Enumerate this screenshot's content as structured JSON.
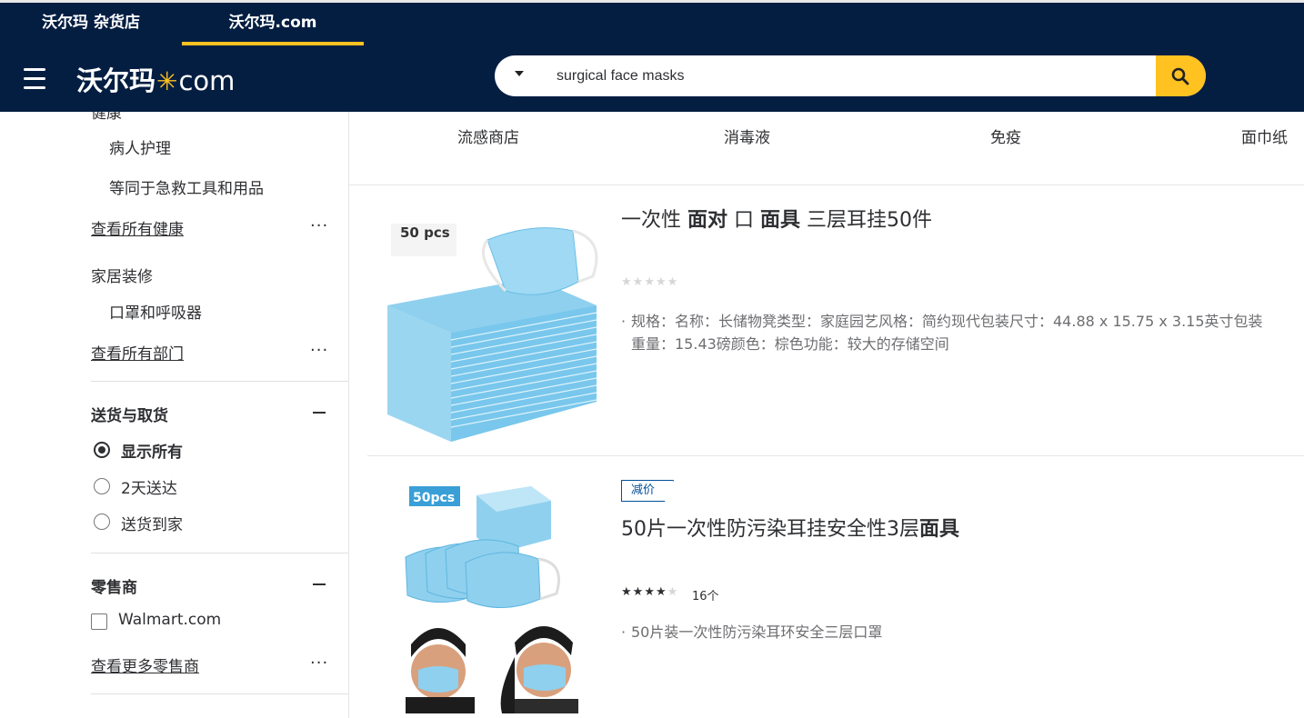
{
  "header": {
    "tabs": [
      {
        "label": "沃尔玛 杂货店",
        "active": false
      },
      {
        "label": "沃尔玛.com",
        "active": true
      }
    ],
    "logo": {
      "cn": "沃尔玛",
      "suffix": "com"
    },
    "search": {
      "value": "surgical face masks"
    },
    "menu_icon": "hamburger-icon",
    "search_icon": "search-icon"
  },
  "sidebar": {
    "partial_heading": "健康",
    "health_items": [
      "病人护理",
      "等同于急救工具和用品"
    ],
    "view_all_health": "查看所有健康",
    "home_heading": "家居装修",
    "home_items": [
      "口罩和呼吸器"
    ],
    "view_all_departments": "查看所有部门",
    "more_dots": "···",
    "delivery": {
      "heading": "送货与取货",
      "options": [
        {
          "label": "显示所有",
          "selected": true
        },
        {
          "label": "2天送达",
          "selected": false
        },
        {
          "label": "送货到家",
          "selected": false
        }
      ]
    },
    "retailer": {
      "heading": "零售商",
      "options": [
        {
          "label": "Walmart.com",
          "checked": false
        }
      ],
      "view_more": "查看更多零售商"
    }
  },
  "categories": [
    "流感商店",
    "消毒液",
    "免疫",
    "面巾纸"
  ],
  "products": [
    {
      "image_label": "50 pcs",
      "title_parts": [
        {
          "text": "一次性 ",
          "bold": false
        },
        {
          "text": "面对",
          "bold": true
        },
        {
          "text": " 口 ",
          "bold": false
        },
        {
          "text": "面具",
          "bold": true
        },
        {
          "text": " 三层耳挂50件",
          "bold": false
        }
      ],
      "rating": 0,
      "rating_max": 5,
      "reviews": "",
      "description": "规格：名称：长储物凳类型：家庭园艺风格：简约现代包装尺寸：44.88 x 15.75 x 3.15英寸包装重量：15.43磅颜色：棕色功能：较大的存储空间",
      "bullet": "·"
    },
    {
      "badge": "减价",
      "image_label": "50pcs",
      "title_parts": [
        {
          "text": "50片一次性防污染耳挂安全性3层",
          "bold": false
        },
        {
          "text": "面具",
          "bold": true
        }
      ],
      "rating": 4,
      "rating_max": 5,
      "reviews": "16个",
      "description": "50片装一次性防污染耳环安全三层口罩",
      "bullet": "·"
    }
  ],
  "colors": {
    "header_bg": "#041e42",
    "accent": "#ffc220",
    "badge": "#004f9a",
    "mask_blue": "#8fd0ee"
  }
}
